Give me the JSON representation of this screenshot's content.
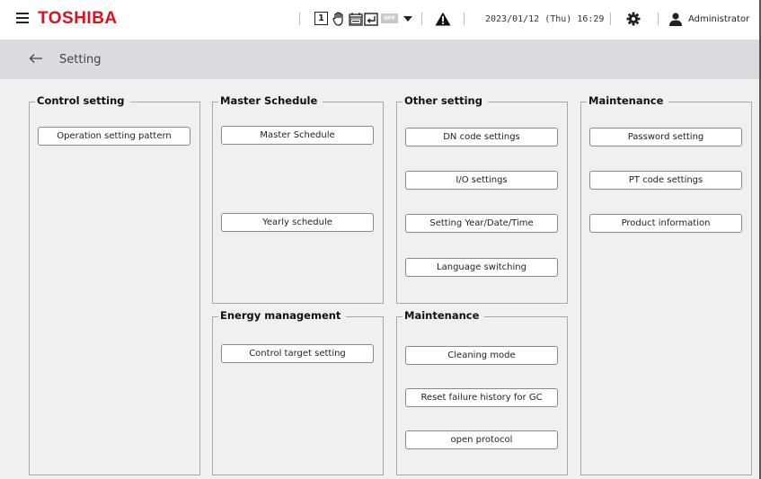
{
  "header": {
    "brand": "TOSHIBA",
    "status_box_number": "1",
    "off_badge": "OFF",
    "datetime": "2023/01/12 (Thu) 16:29",
    "user": "Administrator"
  },
  "breadcrumb": {
    "title": "Setting"
  },
  "groups": {
    "control_setting": {
      "title": "Control setting",
      "buttons": [
        "Operation setting pattern"
      ]
    },
    "master_schedule": {
      "title": "Master Schedule",
      "buttons": [
        "Master Schedule",
        "Yearly schedule"
      ]
    },
    "energy_management": {
      "title": "Energy management",
      "buttons": [
        "Control target setting"
      ]
    },
    "other_setting": {
      "title": "Other setting",
      "buttons": [
        "DN code settings",
        "I/O settings",
        "Setting Year/Date/Time",
        "Language switching"
      ]
    },
    "maintenance_middle": {
      "title": "Maintenance",
      "buttons": [
        "Cleaning mode",
        "Reset failure history for GC",
        "open protocol"
      ]
    },
    "maintenance_right": {
      "title": "Maintenance",
      "buttons": [
        "Password setting",
        "PT code settings",
        "Product information"
      ]
    }
  },
  "colors": {
    "brand": "#d8121f",
    "background": "#f0f0f2",
    "breadcrumb_bar": "#dcdce0"
  },
  "icons": [
    "menu-icon",
    "hand-icon",
    "schedule-off-icon",
    "return-icon",
    "dropdown-icon",
    "warning-icon",
    "gear-icon",
    "user-icon",
    "back-arrow-icon"
  ]
}
